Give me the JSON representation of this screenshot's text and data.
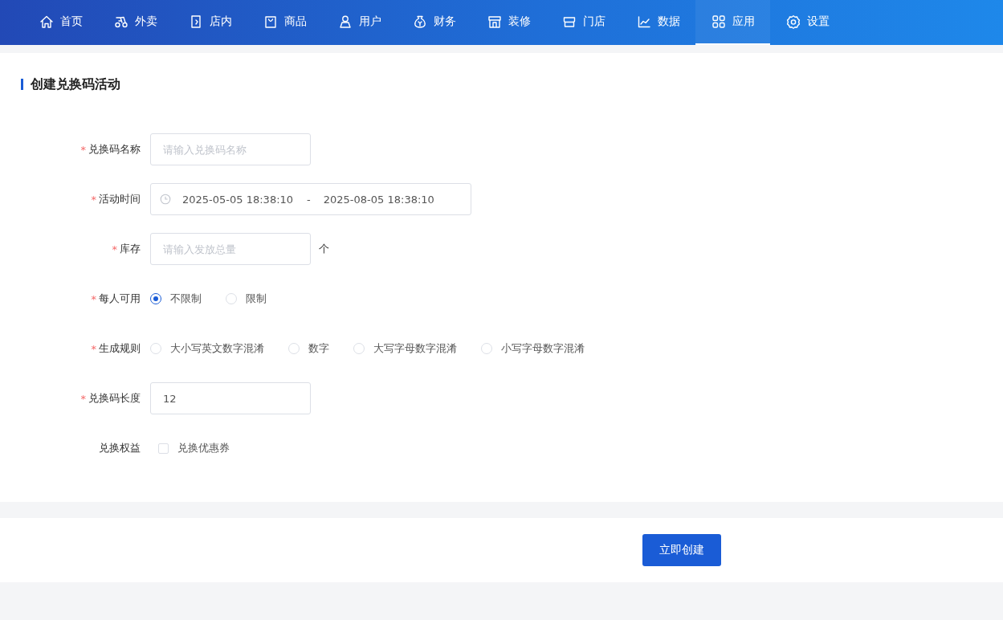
{
  "nav": {
    "items": [
      {
        "label": "首页",
        "selected": false
      },
      {
        "label": "外卖",
        "selected": false
      },
      {
        "label": "店内",
        "selected": false
      },
      {
        "label": "商品",
        "selected": false
      },
      {
        "label": "用户",
        "selected": false
      },
      {
        "label": "财务",
        "selected": false
      },
      {
        "label": "装修",
        "selected": false
      },
      {
        "label": "门店",
        "selected": false
      },
      {
        "label": "数据",
        "selected": false
      },
      {
        "label": "应用",
        "selected": true
      },
      {
        "label": "设置",
        "selected": false
      }
    ]
  },
  "card": {
    "title": "创建兑换码活动",
    "fields": [
      {
        "kind": "text",
        "required_mark": "*",
        "label": "兑换码名称",
        "placeholder": "请输入兑换码名称"
      },
      {
        "kind": "daterange",
        "required_mark": "*",
        "label": "活动时间",
        "start": "2025-05-05 18:38:10",
        "separator": "-",
        "end": "2025-08-05 18:38:10"
      },
      {
        "kind": "text",
        "required_mark": "*",
        "label": "库存",
        "placeholder": "请输入发放总量",
        "suffix": "个"
      },
      {
        "kind": "radio",
        "required_mark": "*",
        "label": "每人可用",
        "options": [
          {
            "label": "不限制",
            "selected": true
          },
          {
            "label": "限制",
            "selected": false
          }
        ]
      },
      {
        "kind": "radio",
        "required_mark": "*",
        "label": "生成规则",
        "options": [
          {
            "label": "大小写英文数字混淆",
            "selected": false
          },
          {
            "label": "数字",
            "selected": false
          },
          {
            "label": "大写字母数字混淆",
            "selected": false
          },
          {
            "label": "小写字母数字混淆",
            "selected": false
          }
        ]
      },
      {
        "kind": "text",
        "required_mark": "*",
        "label": "兑换码长度",
        "value": "12"
      },
      {
        "kind": "checkbox",
        "label": "兑换权益",
        "options": [
          {
            "label": "兑换优惠券",
            "checked": false
          }
        ]
      }
    ]
  },
  "footer": {
    "button": "立即创建"
  }
}
